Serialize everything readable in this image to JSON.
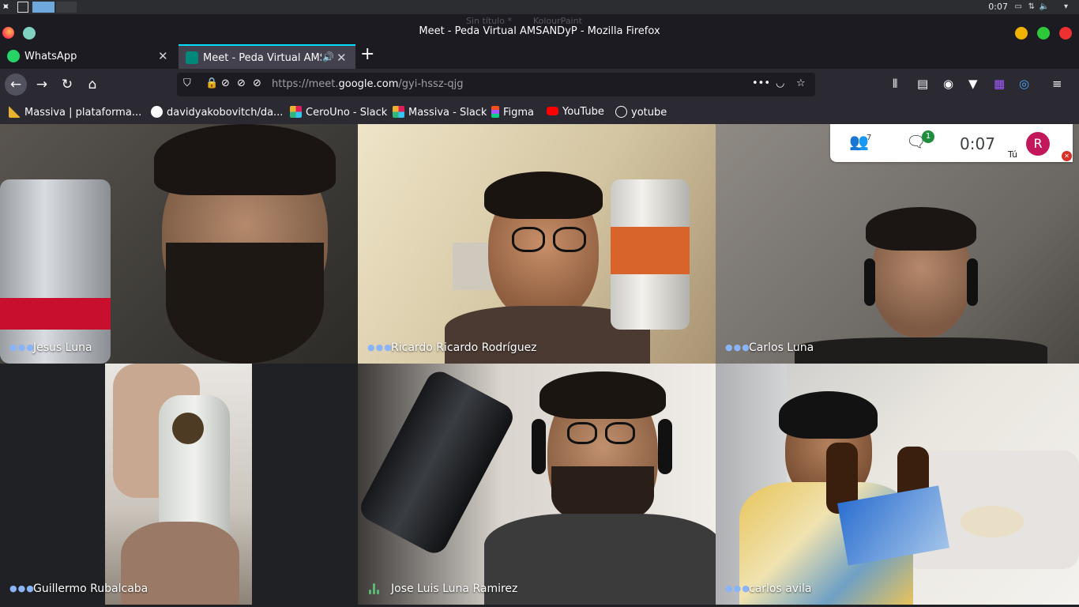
{
  "system": {
    "clock": "0:07",
    "ghost_titles": [
      "Sin título *",
      "KolourPaint"
    ]
  },
  "window": {
    "title": "Meet - Peda Virtual AMSANDyP - Mozilla Firefox"
  },
  "tabs": [
    {
      "label": "WhatsApp",
      "icon": "whatsapp-icon",
      "active": false
    },
    {
      "label": "Meet - Peda Virtual AMSANDyP",
      "icon": "meet-icon",
      "active": true
    }
  ],
  "urlbar": {
    "url_prefix": "https://meet.",
    "url_domain": "google.com",
    "url_path": "/gyi-hssz-qjg"
  },
  "bookmarks": [
    {
      "label": "Massiva | plataforma...",
      "icon": "massiva-icon",
      "color": "#e8b130"
    },
    {
      "label": "davidyakobovitch/da...",
      "icon": "github-icon",
      "color": "#fbfbfe"
    },
    {
      "label": "CeroUno - Slack",
      "icon": "slack-icon",
      "color": "#e01e5a"
    },
    {
      "label": "Massiva - Slack",
      "icon": "slack-icon",
      "color": "#36c5f0"
    },
    {
      "label": "Figma",
      "icon": "figma-icon",
      "color": "#a259ff"
    },
    {
      "label": "YouTube",
      "icon": "youtube-icon",
      "color": "#ff0000"
    },
    {
      "label": "yotube",
      "icon": "globe-icon",
      "color": "#fbfbfe"
    }
  ],
  "meet": {
    "participants_count": "7",
    "chat_badge": "1",
    "timer": "0:07",
    "self_initial": "R",
    "self_label": "Tú",
    "tiles": [
      {
        "name": "Jesus Luna",
        "speaking": false
      },
      {
        "name": "Ricardo Ricardo Rodríguez",
        "speaking": false
      },
      {
        "name": "Carlos Luna",
        "speaking": false
      },
      {
        "name": "Guillermo Rubalcaba",
        "speaking": false
      },
      {
        "name": "Jose Luis Luna Ramirez",
        "speaking": true
      },
      {
        "name": "carlos avila",
        "speaking": false
      }
    ]
  }
}
